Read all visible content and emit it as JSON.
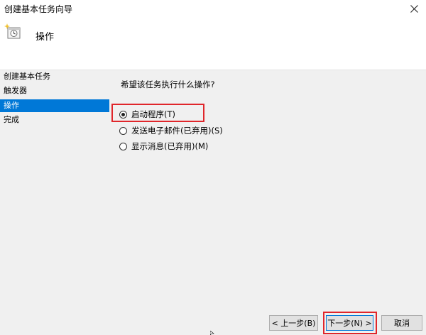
{
  "window": {
    "title": "创建基本任务向导",
    "close_icon": "close-icon"
  },
  "header": {
    "title": "操作",
    "icon": "task-scheduler-icon"
  },
  "sidebar": {
    "items": [
      {
        "label": "创建基本任务",
        "active": false
      },
      {
        "label": "触发器",
        "active": false
      },
      {
        "label": "操作",
        "active": true
      },
      {
        "label": "完成",
        "active": false
      }
    ]
  },
  "main": {
    "prompt": "希望该任务执行什么操作?",
    "options": [
      {
        "label": "启动程序(T)",
        "selected": true
      },
      {
        "label": "发送电子邮件(已弃用)(S)",
        "selected": false
      },
      {
        "label": "显示消息(已弃用)(M)",
        "selected": false
      }
    ]
  },
  "buttons": {
    "back": "< 上一步(B)",
    "next": "下一步(N) >",
    "cancel": "取消"
  },
  "colors": {
    "accent": "#0078d7",
    "highlight": "#e0262b"
  }
}
